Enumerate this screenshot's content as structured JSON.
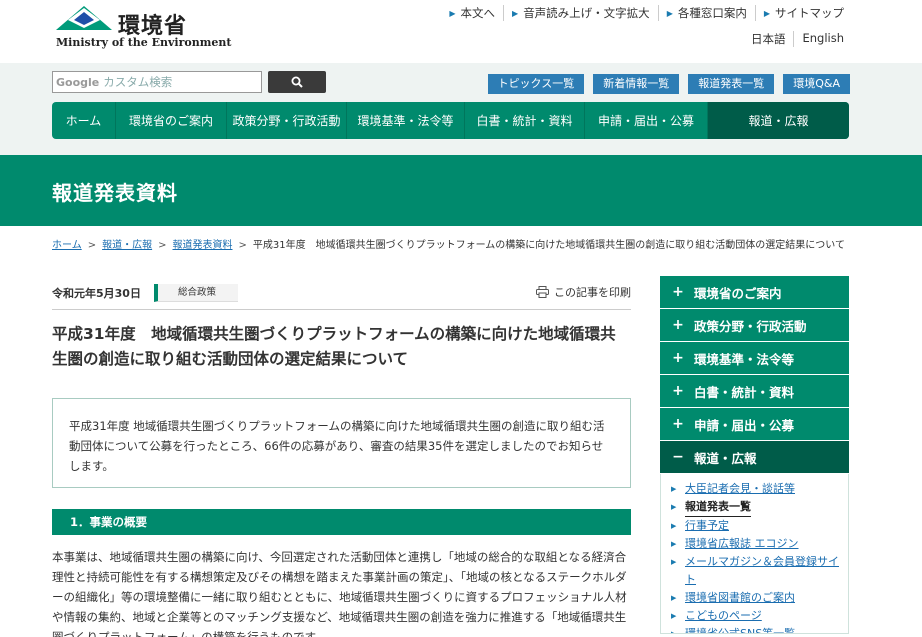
{
  "header": {
    "logo_jp": "環境省",
    "logo_en": "Ministry of the Environment",
    "util_links": [
      "本文へ",
      "音声読み上げ・文字拡大",
      "各種窓口案内",
      "サイトマップ"
    ],
    "lang_links": [
      "日本語",
      "English"
    ]
  },
  "search": {
    "google_label": "Google",
    "placeholder": "カスタム検索"
  },
  "quick_links": [
    "トピックス一覧",
    "新着情報一覧",
    "報道発表一覧",
    "環境Q&A"
  ],
  "global_nav": [
    "ホーム",
    "環境省のご案内",
    "政策分野・行政活動",
    "環境基準・法令等",
    "白書・統計・資料",
    "申請・届出・公募",
    "報道・広報"
  ],
  "page_title": "報道発表資料",
  "breadcrumb": {
    "links": [
      "ホーム",
      "報道・広報",
      "報道発表資料"
    ],
    "current": "平成31年度　地域循環共生圏づくりプラットフォームの構築に向けた地域循環共生圏の創造に取り組む活動団体の選定結果について"
  },
  "article": {
    "date": "令和元年5月30日",
    "category": "総合政策",
    "print_label": "この記事を印刷",
    "title": "平成31年度　地域循環共生圏づくりプラットフォームの構築に向けた地域循環共生圏の創造に取り組む活動団体の選定結果について",
    "summary": "平成31年度 地域循環共生圏づくりプラットフォームの構築に向けた地域循環共生圏の創造に取り組む活動団体について公募を行ったところ、66件の応募があり、審査の結果35件を選定しましたのでお知らせします。",
    "section1_heading": "1．事業の概要",
    "section1_body": "本事業は、地域循環共生圏の構築に向け、今回選定された活動団体と連携し「地域の総合的な取組となる経済合理性と持続可能性を有する構想策定及びその構想を踏まえた事業計画の策定」、「地域の核となるステークホルダーの組織化」等の環境整備に一緒に取り組むとともに、地域循環共生圏づくりに資するプロフェッショナル人材や情報の集約、地域と企業等とのマッチング支援など、地域循環共生圏の創造を強力に推進する「地域循環共生圏づくりプラットフォーム」の構築を行うものです。"
  },
  "side_nav": {
    "items": [
      {
        "label": "環境省のご案内",
        "sign": "+"
      },
      {
        "label": "政策分野・行政活動",
        "sign": "+"
      },
      {
        "label": "環境基準・法令等",
        "sign": "+"
      },
      {
        "label": "白書・統計・資料",
        "sign": "+"
      },
      {
        "label": "申請・届出・公募",
        "sign": "+"
      },
      {
        "label": "報道・広報",
        "sign": "−"
      }
    ],
    "sub_items": [
      "大臣記者会見・談話等",
      "報道発表一覧",
      "行事予定",
      "環境省広報誌 エコジン",
      "メールマガジン＆会員登録サイト",
      "環境省図書館のご案内",
      "こどものページ",
      "環境省公式SNS等一覧"
    ]
  },
  "colors": {
    "brand_green": "#008a6d",
    "dark_green": "#005c49",
    "quick_blue": "#2d7db5",
    "link_blue": "#1a6db0"
  }
}
